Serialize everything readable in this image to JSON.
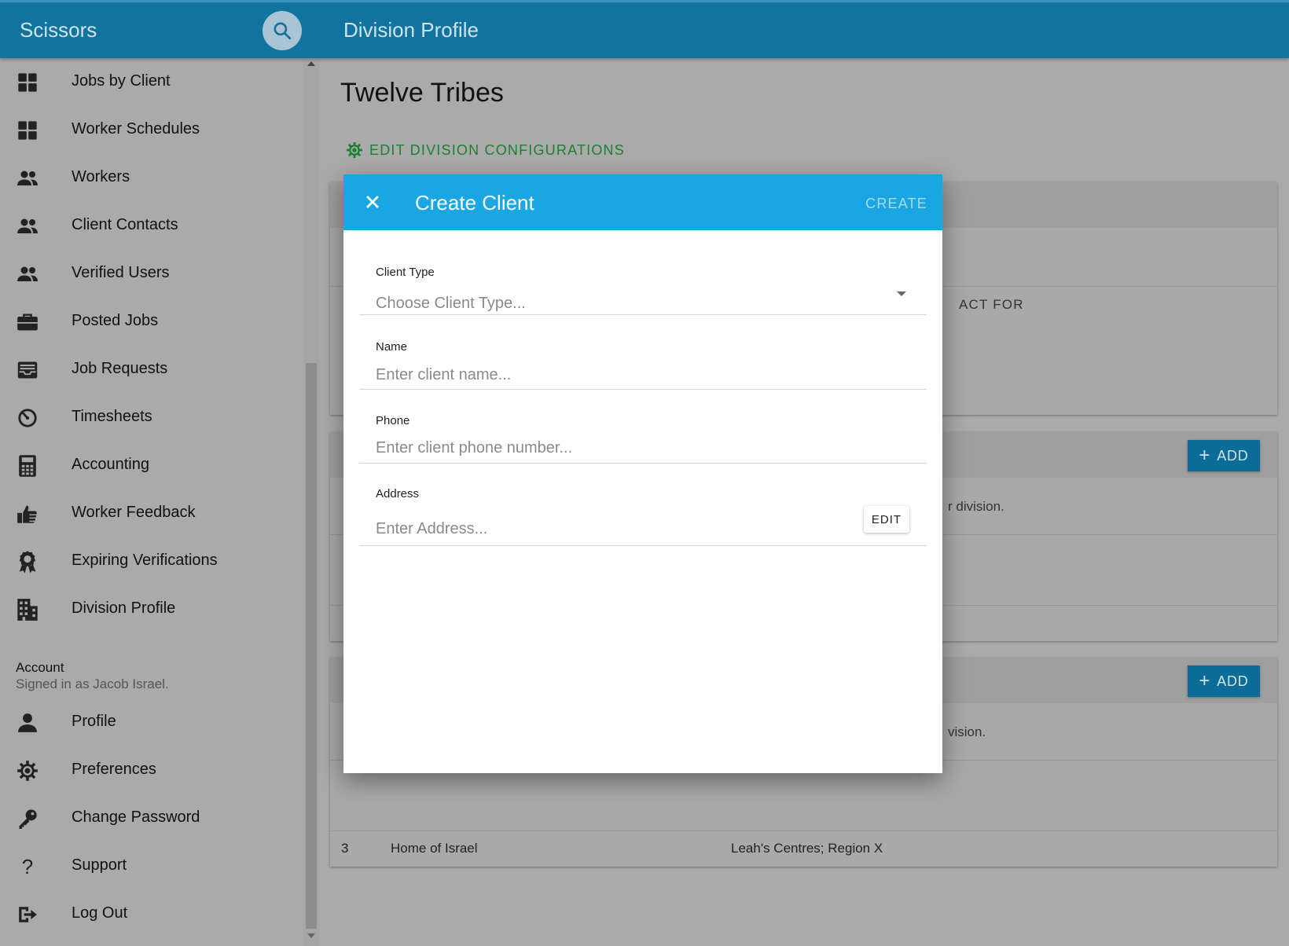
{
  "topbar": {
    "brand": "Scissors",
    "page_title": "Division Profile"
  },
  "sidebar": {
    "items": [
      {
        "label": "Jobs by Client",
        "icon": "grid-icon"
      },
      {
        "label": "Worker Schedules",
        "icon": "grid-icon"
      },
      {
        "label": "Workers",
        "icon": "people-icon"
      },
      {
        "label": "Client Contacts",
        "icon": "people-icon"
      },
      {
        "label": "Verified Users",
        "icon": "people-icon"
      },
      {
        "label": "Posted Jobs",
        "icon": "briefcase-icon"
      },
      {
        "label": "Job Requests",
        "icon": "inbox-icon"
      },
      {
        "label": "Timesheets",
        "icon": "timer-icon"
      },
      {
        "label": "Accounting",
        "icon": "calculator-icon"
      },
      {
        "label": "Worker Feedback",
        "icon": "thumbs-up-icon"
      },
      {
        "label": "Expiring Verifications",
        "icon": "award-icon"
      },
      {
        "label": "Division Profile",
        "icon": "building-icon"
      }
    ],
    "account": {
      "title": "Account",
      "signed_in": "Signed in as Jacob Israel.",
      "items": [
        {
          "label": "Profile",
          "icon": "person-icon"
        },
        {
          "label": "Preferences",
          "icon": "gear-icon"
        },
        {
          "label": "Change Password",
          "icon": "key-icon"
        },
        {
          "label": "Support",
          "icon": "question-icon"
        },
        {
          "label": "Log Out",
          "icon": "logout-icon"
        }
      ]
    }
  },
  "main": {
    "title": "Twelve Tribes",
    "edit_config": "EDIT DIVISION CONFIGURATIONS",
    "card1_partial": "ACT FOR",
    "card2_partial": "r division.",
    "card3_partial": "vision.",
    "add_label": "ADD",
    "last_row": {
      "num": "3",
      "name": "Home of Israel",
      "regions": "Leah's Centres; Region X"
    }
  },
  "dialog": {
    "title": "Create Client",
    "create_label": "CREATE",
    "fields": {
      "client_type": {
        "label": "Client Type",
        "placeholder": "Choose Client Type..."
      },
      "name": {
        "label": "Name",
        "placeholder": "Enter client name..."
      },
      "phone": {
        "label": "Phone",
        "placeholder": "Enter client phone number..."
      },
      "address": {
        "label": "Address",
        "placeholder": "Enter Address...",
        "edit_label": "EDIT"
      }
    }
  }
}
